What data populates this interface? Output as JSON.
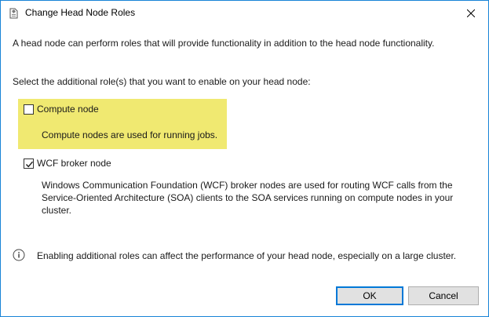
{
  "window": {
    "title": "Change Head Node Roles"
  },
  "intro_text": "A head node can perform roles that will provide functionality in addition to the head node functionality.",
  "select_prompt": "Select the additional role(s) that you want to enable on your head node:",
  "roles": [
    {
      "label": "Compute node",
      "checked": false,
      "highlighted": true,
      "description": "Compute nodes are used for running jobs."
    },
    {
      "label": "WCF broker node",
      "checked": true,
      "highlighted": false,
      "description_lines": [
        "Windows Communication Foundation (WCF) broker nodes are used for routing WCF calls from the",
        "Service-Oriented Architecture (SOA) clients to the SOA services running on compute nodes in your",
        "cluster."
      ]
    }
  ],
  "info_text": "Enabling additional roles can affect the performance of your head node, especially on a large cluster.",
  "buttons": {
    "ok_label": "OK",
    "cancel_label": "Cancel"
  },
  "colors": {
    "highlight": "#f0e971",
    "accent": "#0078d7"
  },
  "icons": {
    "title": "head-node-roles-icon",
    "close": "close-icon",
    "info": "info-icon"
  }
}
